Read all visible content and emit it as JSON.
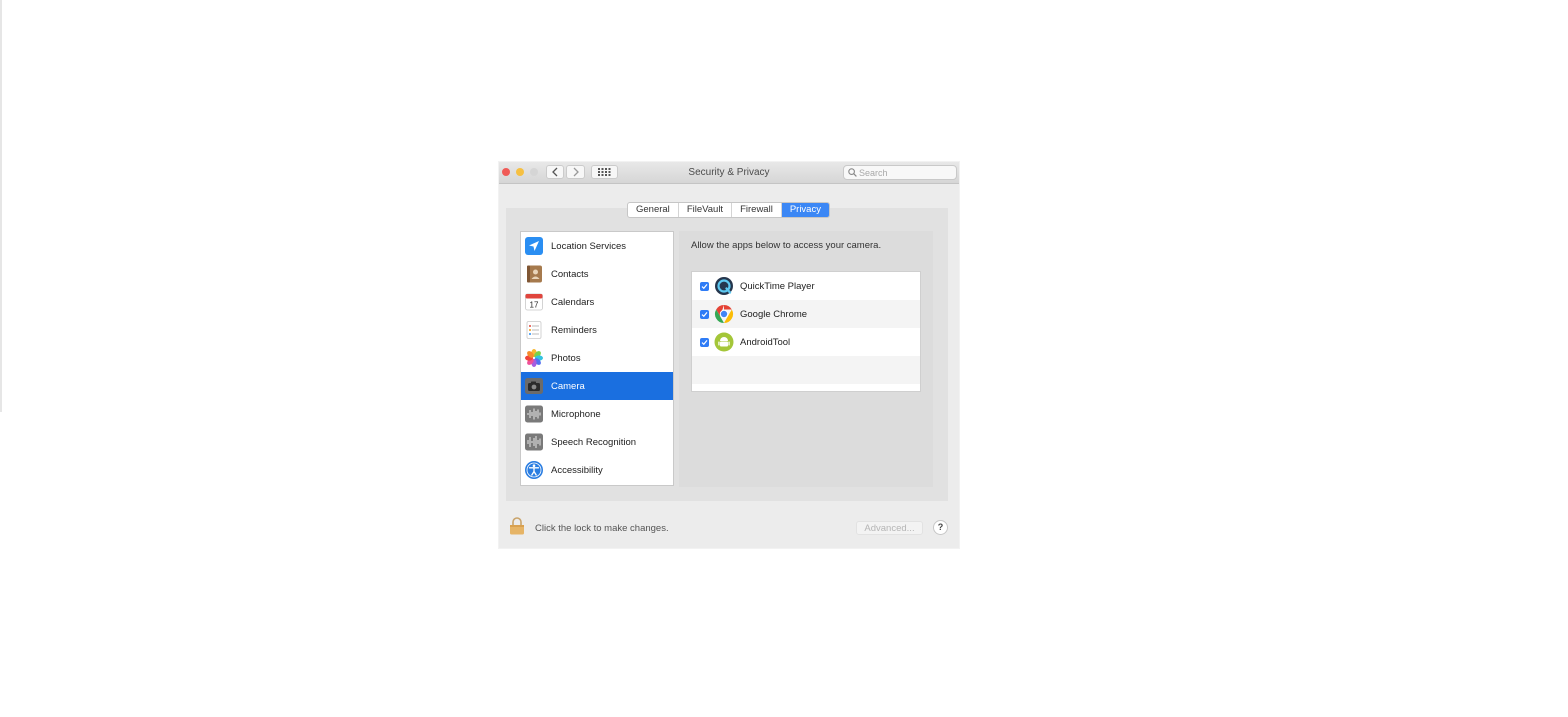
{
  "window": {
    "title": "Security & Privacy",
    "search_placeholder": "Search"
  },
  "tabs": [
    {
      "label": "General",
      "active": false
    },
    {
      "label": "FileVault",
      "active": false
    },
    {
      "label": "Firewall",
      "active": false
    },
    {
      "label": "Privacy",
      "active": true
    }
  ],
  "sidebar": {
    "items": [
      {
        "label": "Location Services",
        "icon": "location-arrow-icon"
      },
      {
        "label": "Contacts",
        "icon": "contacts-book-icon"
      },
      {
        "label": "Calendars",
        "icon": "calendar-icon",
        "icon_text": "17"
      },
      {
        "label": "Reminders",
        "icon": "reminders-list-icon"
      },
      {
        "label": "Photos",
        "icon": "photos-flower-icon"
      },
      {
        "label": "Camera",
        "icon": "camera-icon",
        "selected": true
      },
      {
        "label": "Microphone",
        "icon": "microphone-waveform-icon"
      },
      {
        "label": "Speech Recognition",
        "icon": "speech-waveform-icon"
      },
      {
        "label": "Accessibility",
        "icon": "accessibility-icon"
      }
    ]
  },
  "main": {
    "description": "Allow the apps below to access your camera.",
    "apps": [
      {
        "name": "QuickTime Player",
        "checked": true,
        "icon": "quicktime-icon"
      },
      {
        "name": "Google Chrome",
        "checked": true,
        "icon": "chrome-icon"
      },
      {
        "name": "AndroidTool",
        "checked": true,
        "icon": "android-icon"
      }
    ]
  },
  "footer": {
    "lock_text": "Click the lock to make changes.",
    "advanced_label": "Advanced...",
    "help_label": "?"
  },
  "colors": {
    "accent": "#3b87f5",
    "selection": "#1a6fe0",
    "close": "#f05b57",
    "minimize": "#f6c042"
  }
}
